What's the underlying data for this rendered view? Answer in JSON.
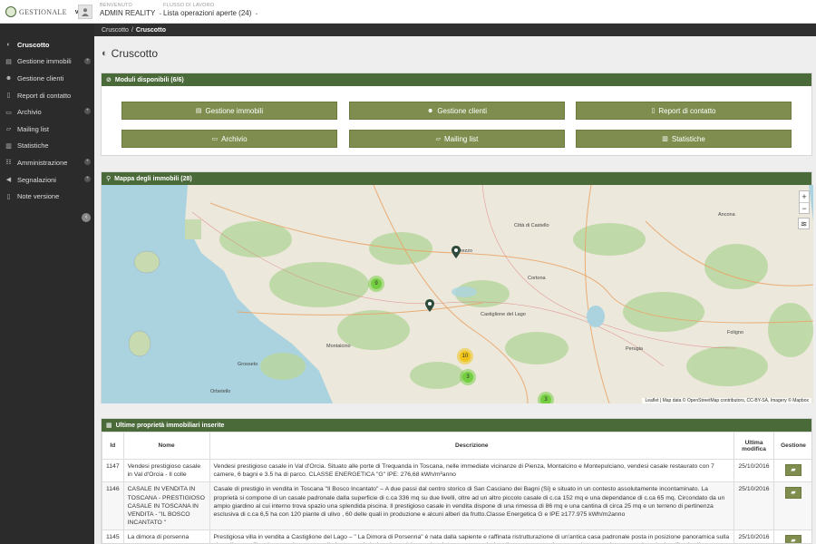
{
  "app": {
    "name": "GESTIONALE",
    "version": "v0.1"
  },
  "user": {
    "welcome_label": "BENVENUTO",
    "name": "ADMIN REALITY"
  },
  "workflow": {
    "label": "FLUSSO DI LAVORO",
    "value": "Lista operazioni aperte (24)"
  },
  "breadcrumb": {
    "parent": "Cruscotto",
    "separator": "/",
    "current": "Cruscotto"
  },
  "sidebar": {
    "items": [
      {
        "label": "Cruscotto",
        "icon": "dashboard-icon",
        "active": true
      },
      {
        "label": "Gestione immobili",
        "icon": "building-icon",
        "expandable": true
      },
      {
        "label": "Gestione clienti",
        "icon": "users-icon"
      },
      {
        "label": "Report di contatto",
        "icon": "book-icon"
      },
      {
        "label": "Archivio",
        "icon": "archive-icon",
        "expandable": true
      },
      {
        "label": "Mailing list",
        "icon": "inbox-icon"
      },
      {
        "label": "Statistiche",
        "icon": "chart-icon"
      },
      {
        "label": "Amministrazione",
        "icon": "sliders-icon",
        "expandable": true
      },
      {
        "label": "Segnalazioni",
        "icon": "bullhorn-icon",
        "expandable": true
      },
      {
        "label": "Note versione",
        "icon": "file-icon"
      }
    ]
  },
  "page": {
    "title": "Cruscotto"
  },
  "modules": {
    "title": "Moduli disponibili (6/6)",
    "buttons": [
      {
        "label": "Gestione immobili",
        "icon": "building-icon"
      },
      {
        "label": "Gestione clienti",
        "icon": "users-icon"
      },
      {
        "label": "Report di contatto",
        "icon": "book-icon"
      },
      {
        "label": "Archivio",
        "icon": "archive-icon"
      },
      {
        "label": "Mailing list",
        "icon": "inbox-icon"
      },
      {
        "label": "Statistiche",
        "icon": "chart-icon"
      }
    ]
  },
  "map": {
    "title": "Mappa degli immobili (28)",
    "zoom_in": "+",
    "zoom_out": "−",
    "attribution": "Leaflet | Map data © OpenStreetMap contributors, CC-BY-SA, Imagery © Mapbox",
    "clusters": [
      "9",
      "10",
      "3",
      "3"
    ],
    "cities": [
      "Arezzo",
      "Perugia",
      "Città di Castello",
      "Castiglione del Lago",
      "Montalcino",
      "Grosseto",
      "Orbetello",
      "Cortona",
      "Ancona",
      "Foligno"
    ]
  },
  "properties": {
    "title": "Ultime proprietà immobiliari inserite",
    "columns": {
      "id": "Id",
      "name": "Nome",
      "description": "Descrizione",
      "modified": "Ultima modifica",
      "manage": "Gestione"
    },
    "rows": [
      {
        "id": "1147",
        "name": "Vendesi prestigioso casale in Val d'Orcia - Il colle",
        "description": "Vendesi prestigioso casale in Val d'Orcia. Situato alle porte di Trequanda in Toscana, nelle immediate vicinanze di Pienza, Montalcino e Montepulciano, vendesi casale restaurato con 7 camere, 6 bagni e 3.5 ha di parco. CLASSE ENERGETICA \"G\" IPE: 276,68 kWh/m²anno",
        "modified": "25/10/2016"
      },
      {
        "id": "1146",
        "name": "CASALE IN VENDITA IN TOSCANA - PRESTIGIOSO CASALE IN TOSCANA IN VENDITA - \"IL BOSCO INCANTATO \"",
        "description": "Casale di prestigio in vendita in Toscana \"Il Bosco Incantato\" – A due passi dal centro storico di San Casciano dei Bagni (Si) e situato in un contesto assolutamente incontaminato. La proprietà si compone di un casale padronale dalla superficie di c.ca 336 mq su due livelli, oltre ad un altro piccolo casale di c.ca 152 mq e una dependance di c.ca 65 mq. Circondato da un ampio giardino al cui interno trova spazio una splendida piscina. Il prestigioso casale in vendita dispone di una rimessa di 86 mq e una cantina di circa 25 mq e un terreno di pertinenza esclusiva di c.ca 6,5 ha con 120 piante di ulivo , 60 delle quali in produzione e alcuni alberi da frutto.Classe Energetica G e IPE ≥177.975 kWh/m2anno",
        "modified": "25/10/2016"
      },
      {
        "id": "1145",
        "name": "La dimora di porsenna",
        "description": "Prestigiosa villa in vendita a Castiglione del Lago – \" La Dimora di Porsenna\" è nata dalla sapiente e raffinata ristrutturazione di un'antica casa padronale posta in posizione panoramica sulla cima di una collina, immersa in un parco di piante secolari, dove in posizione soleggiata sorge una piscina di recente costruzione completamente immersa nel verde. La villa si sviluppa su tre piani per",
        "modified": "25/10/2016"
      }
    ]
  },
  "colors": {
    "accent": "#4a6a3a",
    "button": "#7f8e4f",
    "sidebar": "#2b2b2b"
  }
}
